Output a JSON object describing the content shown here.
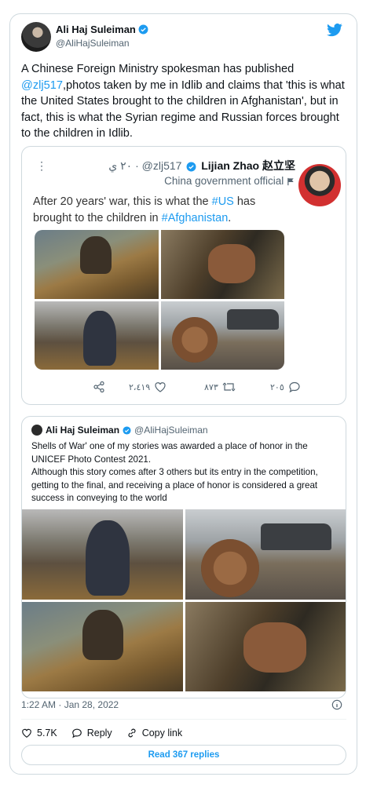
{
  "tweet": {
    "author_name": "Ali Haj Suleiman",
    "author_handle": "@AliHajSuleiman",
    "text_before": "A Chinese Foreign Ministry spokesman has published ",
    "mention": "@zlj517",
    "text_after": ",photos taken by me in Idlib and claims that 'this is what the United States brought to the children in Afghanistan', but in fact, this is what the Syrian regime and Russian forces brought to the children in Idlib.",
    "timestamp": "1:22 AM · Jan 28, 2022",
    "likes": "5.7K",
    "reply_label": "Reply",
    "copy_label": "Copy link",
    "read_replies": "Read 367 replies"
  },
  "quote1": {
    "dots": "⋮",
    "time": "٢٠ ي",
    "handle": "@zlj517",
    "name": "Lijian Zhao 赵立坚",
    "subtitle": "China government official",
    "text_1": "After 20 years' war, this is what the ",
    "tag_1": "#US",
    "text_2": " has brought to the children in ",
    "tag_2": "#Afghanistan",
    "text_3": ".",
    "shares": "٢،٤١٩",
    "retweets": "٨٧٣",
    "replies": "٢٠٥"
  },
  "quote2": {
    "name": "Ali Haj Suleiman",
    "handle": "@AliHajSuleiman",
    "text_line1": "Shells of War' one of my stories was awarded a place of honor in the UNICEF Photo Contest 2021.",
    "text_line2": "Although this story comes after 3 others but its entry in the competition, getting to the final, and receiving a place of honor is considered a great success in conveying to the world"
  },
  "colors": {
    "accent": "#1d9bf0",
    "text": "#0f1419",
    "muted": "#536471",
    "border": "#cfd9de"
  },
  "icons": [
    "verified-icon",
    "twitter-bird-icon",
    "share-icon",
    "heart-icon",
    "retweet-icon",
    "reply-icon",
    "info-icon",
    "link-icon",
    "flag-icon"
  ]
}
